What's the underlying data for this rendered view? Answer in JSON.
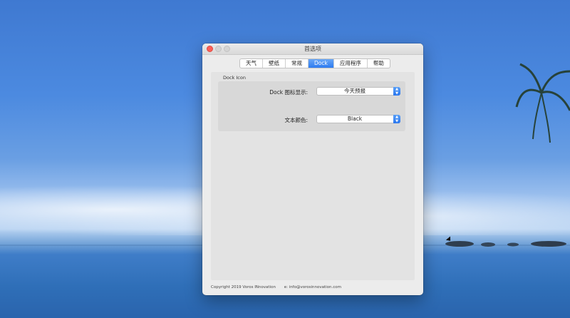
{
  "window": {
    "title": "首选项"
  },
  "tabs": [
    {
      "label": "天气"
    },
    {
      "label": "壁纸"
    },
    {
      "label": "常规"
    },
    {
      "label": "Dock",
      "active": true
    },
    {
      "label": "应用程序"
    },
    {
      "label": "帮助"
    }
  ],
  "dock_icon": {
    "group_label": "Dock Icon",
    "dock_display_label": "Dock 图标显示:",
    "dock_display_value": "今天预报",
    "text_color_label": "文本颜色:",
    "text_color_value": "Black"
  },
  "footer": {
    "copyright": "Copyright 2019 Voros INnovation",
    "email": "e: info@vorosinnovation.com"
  },
  "colors": {
    "accent": "#2d7af0",
    "close_button": "#fc5f57"
  },
  "icons": {
    "popup_arrow": "chevron-up-down-icon",
    "close": "close-icon",
    "minimize": "minimize-icon",
    "zoom": "zoom-icon",
    "cursor": "mouse-pointer-icon"
  }
}
